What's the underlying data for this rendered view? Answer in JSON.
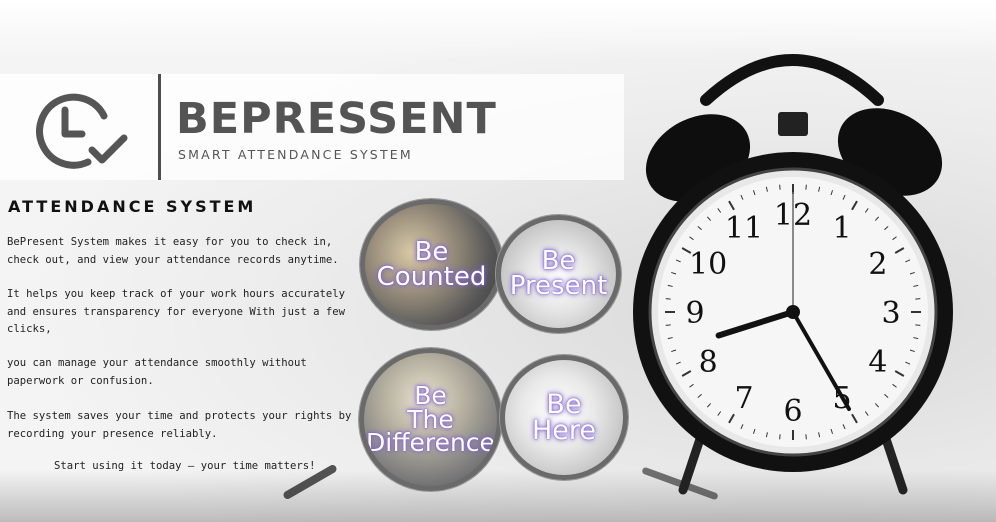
{
  "brand": {
    "name": "BEPRESSENT",
    "tagline": "SMART ATTENDANCE SYSTEM"
  },
  "content": {
    "title": "ATTENDANCE SYSTEM",
    "paragraphs": [
      "BePresent System makes it easy for you to check in,\ncheck out, and view your attendance records anytime.",
      "It helps you keep track of your work hours accurately\nand ensures transparency for everyone With just a few\nclicks,",
      "you can manage your attendance smoothly without\npaperwork or confusion.",
      "The system saves your time and protects your rights by\nrecording your presence reliably."
    ],
    "cta": "Start using it today — your time matters!"
  },
  "bubbles": [
    {
      "text": "Be\nCounted"
    },
    {
      "text": "Be\nPresent"
    },
    {
      "text": "Be\nThe\nDifference"
    },
    {
      "text": "Be\nHere"
    }
  ],
  "clock": {
    "numerals": [
      "12",
      "1",
      "2",
      "3",
      "4",
      "5",
      "6",
      "7",
      "8",
      "9",
      "10",
      "11"
    ],
    "hour": 8,
    "minute": 25
  },
  "colors": {
    "brand_text": "#545454",
    "bubble_glow": "#7b5bd0",
    "clock_body": "#111111"
  },
  "icons": {
    "logo": "clock-check-icon"
  }
}
